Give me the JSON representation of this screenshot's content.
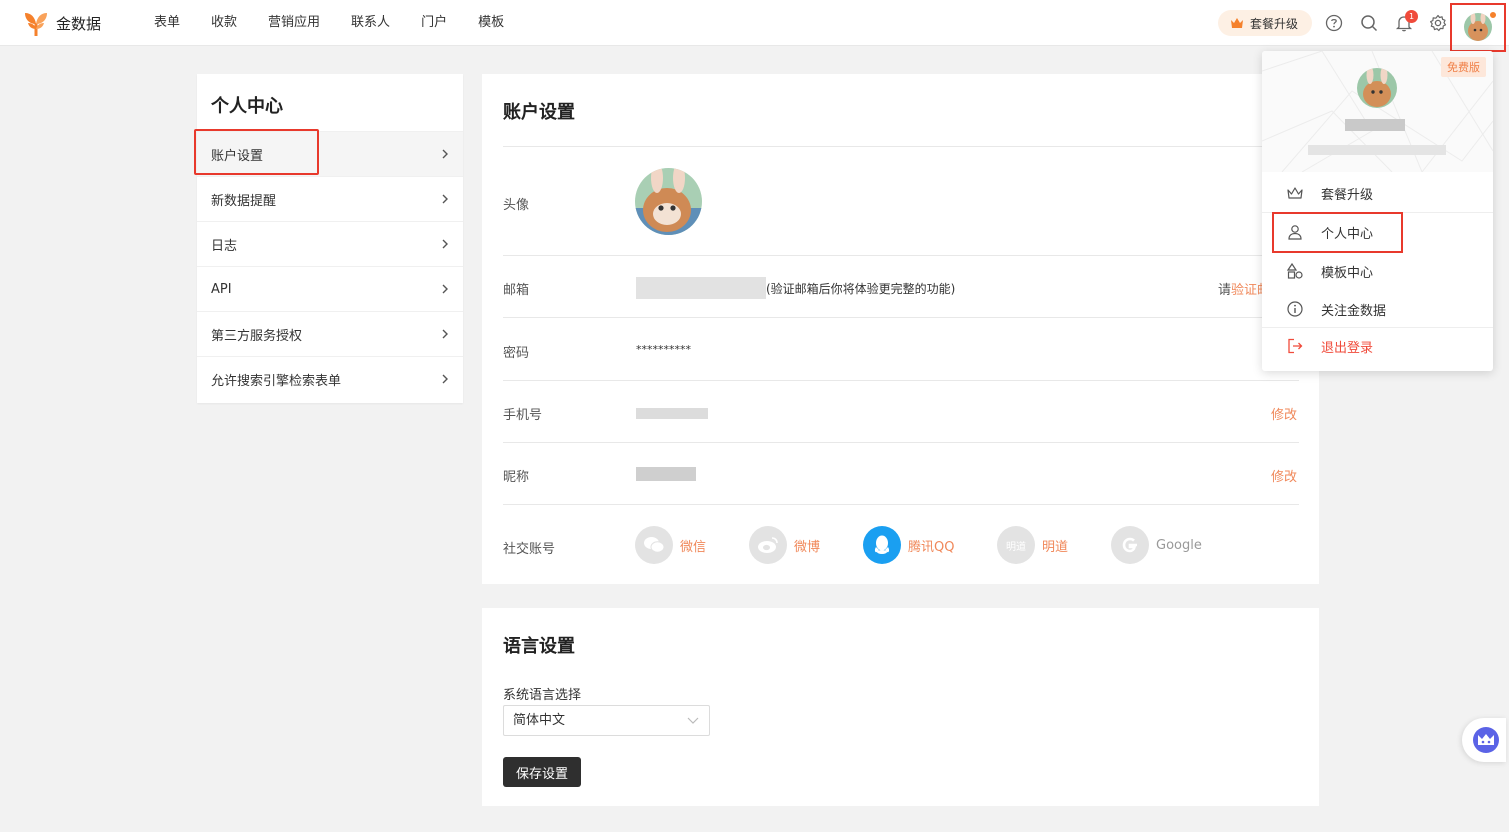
{
  "brand": {
    "name": "金数据",
    "accent": "#f5812c"
  },
  "nav": {
    "items": [
      "表单",
      "收款",
      "营销应用",
      "联系人",
      "门户",
      "模板"
    ]
  },
  "topbar": {
    "upgrade_label": "套餐升级",
    "notification_count": "1",
    "icons": [
      "help-icon",
      "search-icon",
      "bell-icon",
      "gear-icon"
    ]
  },
  "sidebar": {
    "title": "个人中心",
    "items": [
      {
        "label": "账户设置",
        "active": true
      },
      {
        "label": "新数据提醒"
      },
      {
        "label": "日志"
      },
      {
        "label": "API"
      },
      {
        "label": "第三方服务授权"
      },
      {
        "label": "允许搜索引擎检索表单"
      }
    ]
  },
  "account": {
    "title": "账户设置",
    "avatar_label": "头像",
    "email_label": "邮箱",
    "email_hint": "(验证邮箱后你将体验更完整的功能)",
    "email_action_prefix": "请",
    "email_action": "验证邮",
    "password_label": "密码",
    "password_value": "**********",
    "phone_label": "手机号",
    "phone_action": "修改",
    "nickname_label": "昵称",
    "nickname_action": "修改",
    "social_label": "社交账号",
    "social": [
      {
        "name": "微信",
        "icon": "wechat-icon"
      },
      {
        "name": "微博",
        "icon": "weibo-icon"
      },
      {
        "name": "腾讯QQ",
        "icon": "qq-icon"
      },
      {
        "name": "明道",
        "icon": "mingdao-icon",
        "icon_text": "明道"
      },
      {
        "name": "Google",
        "icon": "google-icon"
      }
    ]
  },
  "language": {
    "title": "语言设置",
    "label": "系统语言选择",
    "selected": "简体中文",
    "save_label": "保存设置"
  },
  "dropdown": {
    "badge": "免费版",
    "items": [
      {
        "label": "套餐升级",
        "icon": "crown-icon"
      },
      {
        "label": "个人中心",
        "icon": "user-icon"
      },
      {
        "label": "模板中心",
        "icon": "shapes-icon"
      },
      {
        "label": "关注金数据",
        "icon": "info-icon"
      },
      {
        "label": "退出登录",
        "icon": "logout-icon"
      }
    ]
  },
  "colors": {
    "highlight": "#e8392c",
    "link": "#f0885a",
    "qq": "#1a9ff1",
    "logout": "#f04b3b"
  }
}
